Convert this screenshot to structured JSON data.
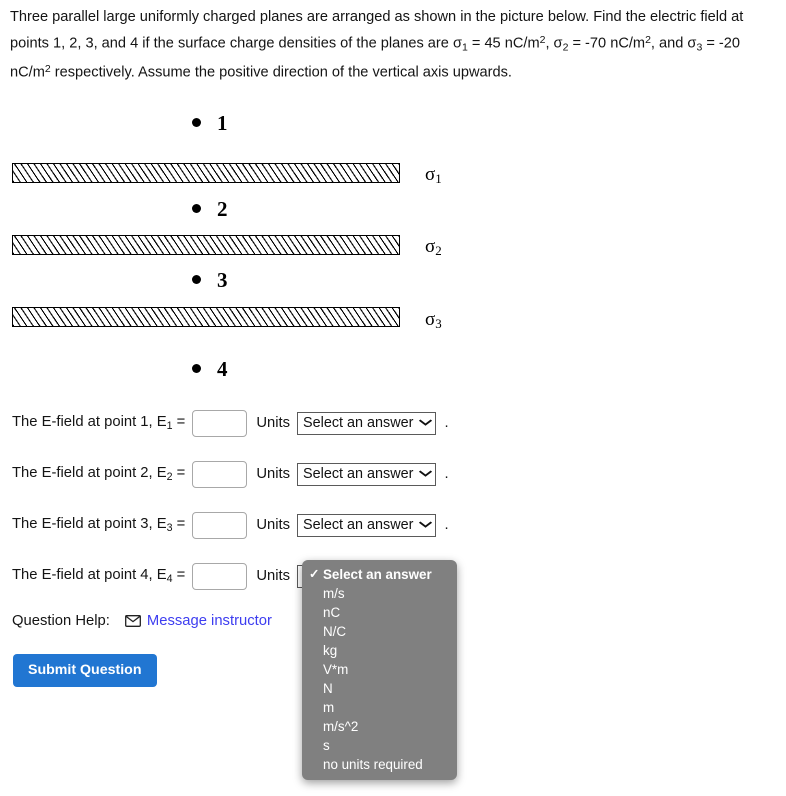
{
  "problem": {
    "text_parts": [
      "Three parallel large uniformly charged planes are arranged as shown in the picture below. Find the electric field at points 1, 2, 3, and 4 if the surface charge densities of the planes are σ",
      "1",
      " = 45 nC/m",
      "2",
      ", σ",
      "2",
      " = -70 nC/m",
      "2",
      ", and σ",
      "3",
      " = -20 nC/m",
      "2",
      " respectively. Assume the positive direction of the vertical axis upwards."
    ],
    "sigma_1_value": "45 nC/m2",
    "sigma_2_value": "-70 nC/m2",
    "sigma_3_value": "-20 nC/m2"
  },
  "figure": {
    "points": [
      {
        "label": "1",
        "marker": "bullet"
      },
      {
        "label": "2",
        "marker": "bullet"
      },
      {
        "label": "3",
        "marker": "bullet"
      },
      {
        "label": "4",
        "marker": "bullet"
      }
    ],
    "planes": [
      {
        "sigma_symbol": "σ",
        "sigma_index": "1"
      },
      {
        "sigma_symbol": "σ",
        "sigma_index": "2"
      },
      {
        "sigma_symbol": "σ",
        "sigma_index": "3"
      }
    ]
  },
  "answers": {
    "units_word": "Units",
    "period": ".",
    "select_placeholder": "Select an answer",
    "chevron": "⌄",
    "rows": [
      {
        "prefix": "The E-field at point 1, E",
        "index": "1",
        "equals": " =",
        "value": "",
        "unit_display": "Select an answer"
      },
      {
        "prefix": "The E-field at point 2, E",
        "index": "2",
        "equals": " =",
        "value": "",
        "unit_display": "Select an answer"
      },
      {
        "prefix": "The E-field at point 3, E",
        "index": "3",
        "equals": " =",
        "value": "",
        "unit_display": "Select an answer"
      },
      {
        "prefix": "The E-field at point 4, E",
        "index": "4",
        "equals": " =",
        "value": "",
        "unit_display": "Select an answer"
      }
    ]
  },
  "dropdown": {
    "open": true,
    "background_color": "#808080",
    "selected_index": 0,
    "check_glyph": "✓",
    "items": [
      "Select an answer",
      "m/s",
      "nC",
      "N/C",
      "kg",
      "V*m",
      "N",
      "m",
      "m/s^2",
      "s",
      "no units required"
    ]
  },
  "help": {
    "label": "Question Help:",
    "link_text": "Message instructor",
    "icon": "envelope-icon",
    "link_color": "#3d3df0"
  },
  "submit": {
    "label": "Submit Question",
    "color": "#2176d2"
  }
}
